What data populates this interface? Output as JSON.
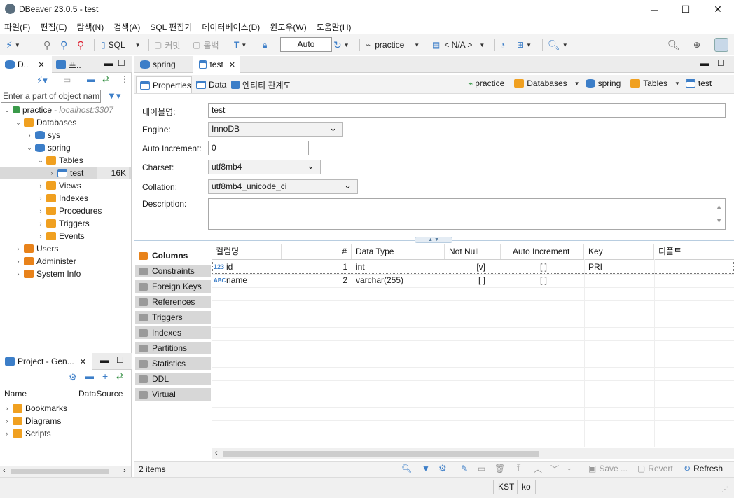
{
  "window": {
    "title": "DBeaver 23.0.5 - test",
    "minimize": "─",
    "maximize": "☐",
    "close": "✕"
  },
  "menu": [
    "파일(F)",
    "편집(E)",
    "탐색(N)",
    "검색(A)",
    "SQL 편집기",
    "데이터베이스(D)",
    "윈도우(W)",
    "도움말(H)"
  ],
  "toolbar": {
    "sql_label": "SQL",
    "commit_label": "커밋",
    "rollback_label": "롤백",
    "transaction_mode": "Auto",
    "datasource": "practice",
    "schema": "< N/A >"
  },
  "navigator": {
    "tab_label": "D..",
    "projects_tab_label": "프..",
    "filter_placeholder": "Enter a part of object nam",
    "tree": [
      {
        "label": "practice",
        "note": " - localhost:3307"
      },
      {
        "label": "Databases"
      },
      {
        "label": "sys"
      },
      {
        "label": "spring"
      },
      {
        "label": "Tables"
      },
      {
        "label": "test",
        "size": "16K"
      },
      {
        "label": "Views"
      },
      {
        "label": "Indexes"
      },
      {
        "label": "Procedures"
      },
      {
        "label": "Triggers"
      },
      {
        "label": "Events"
      },
      {
        "label": "Users"
      },
      {
        "label": "Administer"
      },
      {
        "label": "System Info"
      }
    ]
  },
  "projects": {
    "tab_label": "Project - Gen...",
    "col_name": "Name",
    "col_datasource": "DataSource",
    "items": [
      "Bookmarks",
      "Diagrams",
      "Scripts"
    ]
  },
  "editor": {
    "tabs": [
      "spring",
      "test"
    ],
    "subtabs": [
      "Properties",
      "Data",
      "엔티티 관계도"
    ],
    "breadcrumb": [
      "practice",
      "Databases",
      "spring",
      "Tables",
      "test"
    ],
    "props": {
      "table_name_label": "테이블명:",
      "table_name": "test",
      "engine_label": "Engine:",
      "engine": "InnoDB",
      "auto_inc_label": "Auto Increment:",
      "auto_inc": "0",
      "charset_label": "Charset:",
      "charset": "utf8mb4",
      "collation_label": "Collation:",
      "collation": "utf8mb4_unicode_ci",
      "description_label": "Description:"
    },
    "side_tabs": [
      "Columns",
      "Constraints",
      "Foreign Keys",
      "References",
      "Triggers",
      "Indexes",
      "Partitions",
      "Statistics",
      "DDL",
      "Virtual"
    ],
    "columns_header": [
      "컬럼명",
      "#",
      "Data Type",
      "Not Null",
      "Auto Increment",
      "Key",
      "디폴트"
    ],
    "columns_rows": [
      {
        "name": "id",
        "num": "1",
        "type": "int",
        "notnull": "[v]",
        "autoinc": "[ ]",
        "key": "PRI",
        "default": ""
      },
      {
        "name": "name",
        "num": "2",
        "type": "varchar(255)",
        "notnull": "[ ]",
        "autoinc": "[ ]",
        "key": "",
        "default": ""
      }
    ],
    "items_count": "2 items",
    "save_label": "Save ...",
    "revert_label": "Revert",
    "refresh_label": "Refresh"
  },
  "status": {
    "timezone": "KST",
    "locale": "ko"
  }
}
